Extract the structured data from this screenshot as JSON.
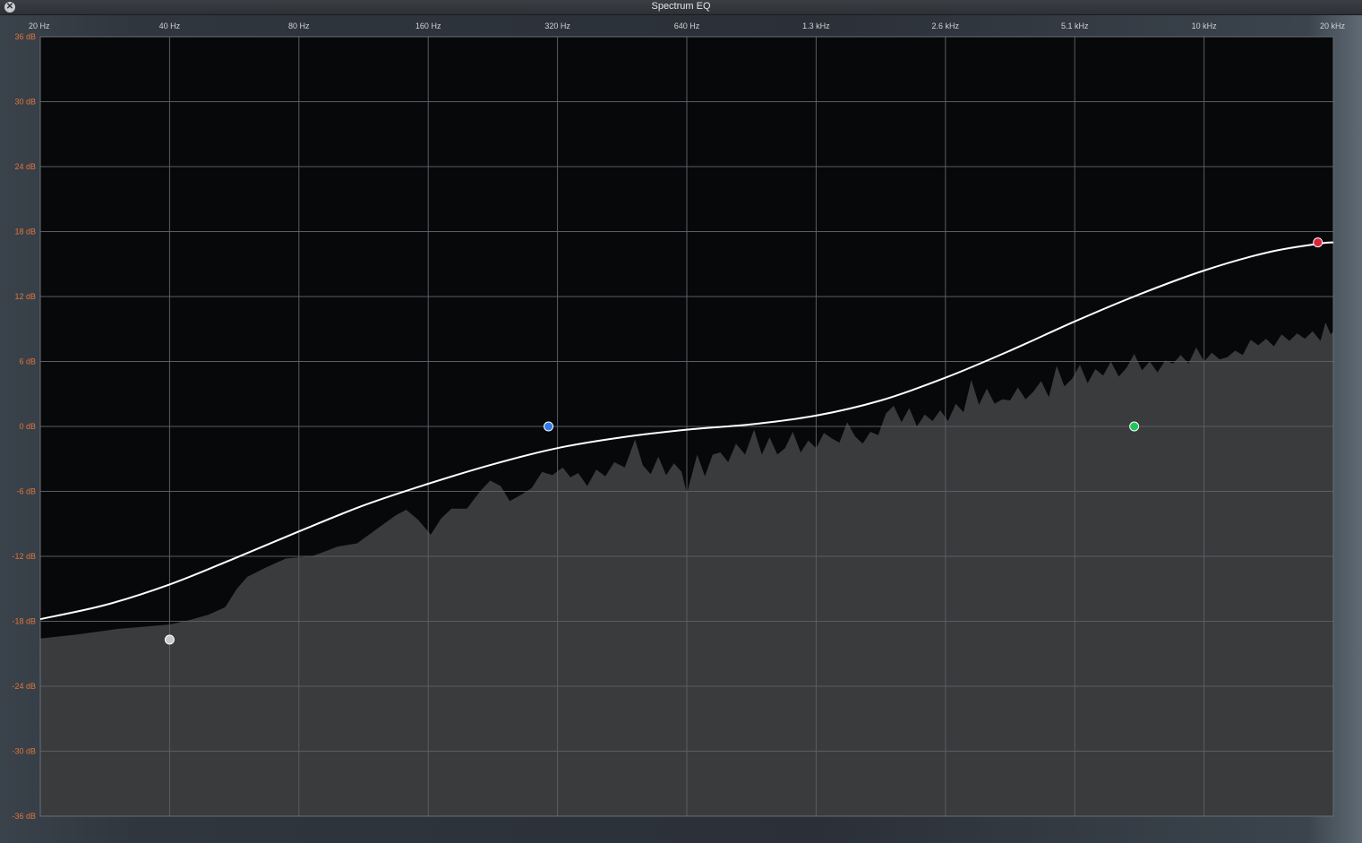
{
  "window": {
    "title": "Spectrum EQ",
    "close_icon": "close-icon"
  },
  "frequency_axis": {
    "labels": [
      "20 Hz",
      "40 Hz",
      "80 Hz",
      "160 Hz",
      "320 Hz",
      "640 Hz",
      "1.3 kHz",
      "2.6 kHz",
      "5.1 kHz",
      "10 kHz",
      "20 kHz"
    ]
  },
  "gain_axis": {
    "labels": [
      "36 dB",
      "30 dB",
      "24 dB",
      "18 dB",
      "12 dB",
      "6 dB",
      "0 dB",
      "-6 dB",
      "-12 dB",
      "-18 dB",
      "-24 dB",
      "-30 dB",
      "-36 dB"
    ],
    "min_db": -36,
    "max_db": 36,
    "label_color": "#e0763a"
  },
  "colors": {
    "plot_background": "#07080a",
    "spectrum_fill": "#3a3b3d",
    "grid": "#5a5d62",
    "eq_curve": "#ffffff"
  },
  "eq_curve": {
    "description_points": [
      [
        0,
        -17.8
      ],
      [
        0.05,
        -16.5
      ],
      [
        0.1,
        -14.6
      ],
      [
        0.15,
        -12.2
      ],
      [
        0.2,
        -9.7
      ],
      [
        0.25,
        -7.3
      ],
      [
        0.3,
        -5.3
      ],
      [
        0.35,
        -3.5
      ],
      [
        0.4,
        -2.0
      ],
      [
        0.45,
        -1.0
      ],
      [
        0.5,
        -0.3
      ],
      [
        0.55,
        0.2
      ],
      [
        0.6,
        1.0
      ],
      [
        0.65,
        2.4
      ],
      [
        0.7,
        4.5
      ],
      [
        0.75,
        7.0
      ],
      [
        0.8,
        9.7
      ],
      [
        0.85,
        12.2
      ],
      [
        0.9,
        14.4
      ],
      [
        0.95,
        16.1
      ],
      [
        0.99,
        16.9
      ],
      [
        1.0,
        17.0
      ]
    ]
  },
  "bands": [
    {
      "name": "low-shelf",
      "freq_pos": 0.1,
      "gain_db": -19.7,
      "color": "#c8c8c8"
    },
    {
      "name": "low-mid",
      "freq_pos": 0.393,
      "gain_db": 0,
      "color": "#2f7be8"
    },
    {
      "name": "high-mid",
      "freq_pos": 0.846,
      "gain_db": 0,
      "color": "#22c55e"
    },
    {
      "name": "high-shelf",
      "freq_pos": 0.988,
      "gain_db": 17.0,
      "color": "#e0223a"
    }
  ],
  "spectrum": {
    "points": [
      [
        0,
        -19.6
      ],
      [
        0.03,
        -19.2
      ],
      [
        0.06,
        -18.7
      ],
      [
        0.1,
        -18.3
      ],
      [
        0.115,
        -17.9
      ],
      [
        0.13,
        -17.4
      ],
      [
        0.143,
        -16.7
      ],
      [
        0.152,
        -15.0
      ],
      [
        0.16,
        -13.9
      ],
      [
        0.175,
        -13.0
      ],
      [
        0.19,
        -12.2
      ],
      [
        0.21,
        -12.0
      ],
      [
        0.23,
        -11.1
      ],
      [
        0.245,
        -10.8
      ],
      [
        0.26,
        -9.5
      ],
      [
        0.275,
        -8.2
      ],
      [
        0.283,
        -7.7
      ],
      [
        0.292,
        -8.6
      ],
      [
        0.302,
        -10.0
      ],
      [
        0.31,
        -8.5
      ],
      [
        0.318,
        -7.6
      ],
      [
        0.33,
        -7.6
      ],
      [
        0.34,
        -6.0
      ],
      [
        0.348,
        -5.0
      ],
      [
        0.356,
        -5.5
      ],
      [
        0.363,
        -6.9
      ],
      [
        0.372,
        -6.3
      ],
      [
        0.38,
        -5.7
      ],
      [
        0.388,
        -4.2
      ],
      [
        0.396,
        -4.5
      ],
      [
        0.404,
        -3.8
      ],
      [
        0.41,
        -4.7
      ],
      [
        0.416,
        -4.3
      ],
      [
        0.423,
        -5.5
      ],
      [
        0.43,
        -4.0
      ],
      [
        0.437,
        -4.6
      ],
      [
        0.444,
        -3.3
      ],
      [
        0.452,
        -3.8
      ],
      [
        0.46,
        -1.2
      ],
      [
        0.466,
        -3.6
      ],
      [
        0.472,
        -4.4
      ],
      [
        0.478,
        -2.8
      ],
      [
        0.484,
        -4.5
      ],
      [
        0.49,
        -3.4
      ],
      [
        0.496,
        -4.2
      ],
      [
        0.5,
        -6.2
      ],
      [
        0.504,
        -4.4
      ],
      [
        0.508,
        -2.6
      ],
      [
        0.514,
        -4.6
      ],
      [
        0.52,
        -2.6
      ],
      [
        0.526,
        -2.4
      ],
      [
        0.532,
        -3.3
      ],
      [
        0.538,
        -1.6
      ],
      [
        0.545,
        -2.6
      ],
      [
        0.552,
        -0.3
      ],
      [
        0.558,
        -2.6
      ],
      [
        0.564,
        -1.0
      ],
      [
        0.57,
        -2.6
      ],
      [
        0.576,
        -2.0
      ],
      [
        0.582,
        -0.5
      ],
      [
        0.588,
        -2.4
      ],
      [
        0.594,
        -1.3
      ],
      [
        0.6,
        -2.0
      ],
      [
        0.606,
        -0.6
      ],
      [
        0.612,
        -1.1
      ],
      [
        0.618,
        -1.5
      ],
      [
        0.624,
        0.4
      ],
      [
        0.63,
        -0.9
      ],
      [
        0.636,
        -1.6
      ],
      [
        0.642,
        -0.5
      ],
      [
        0.648,
        -0.8
      ],
      [
        0.654,
        1.2
      ],
      [
        0.66,
        1.9
      ],
      [
        0.666,
        0.4
      ],
      [
        0.672,
        1.7
      ],
      [
        0.678,
        0.0
      ],
      [
        0.684,
        1.1
      ],
      [
        0.69,
        0.5
      ],
      [
        0.696,
        1.5
      ],
      [
        0.702,
        0.5
      ],
      [
        0.708,
        2.1
      ],
      [
        0.714,
        1.3
      ],
      [
        0.72,
        4.3
      ],
      [
        0.726,
        2.0
      ],
      [
        0.732,
        3.5
      ],
      [
        0.738,
        2.1
      ],
      [
        0.744,
        2.5
      ],
      [
        0.75,
        2.4
      ],
      [
        0.756,
        3.6
      ],
      [
        0.762,
        2.5
      ],
      [
        0.768,
        3.2
      ],
      [
        0.774,
        4.2
      ],
      [
        0.78,
        2.7
      ],
      [
        0.786,
        5.6
      ],
      [
        0.792,
        3.7
      ],
      [
        0.798,
        4.4
      ],
      [
        0.804,
        5.7
      ],
      [
        0.81,
        4.0
      ],
      [
        0.816,
        5.3
      ],
      [
        0.822,
        4.7
      ],
      [
        0.828,
        6.0
      ],
      [
        0.834,
        4.6
      ],
      [
        0.84,
        5.4
      ],
      [
        0.846,
        6.7
      ],
      [
        0.852,
        5.2
      ],
      [
        0.858,
        6.0
      ],
      [
        0.864,
        5.0
      ],
      [
        0.87,
        6.1
      ],
      [
        0.876,
        5.8
      ],
      [
        0.882,
        6.6
      ],
      [
        0.888,
        5.8
      ],
      [
        0.894,
        7.3
      ],
      [
        0.9,
        6.0
      ],
      [
        0.906,
        6.8
      ],
      [
        0.912,
        6.2
      ],
      [
        0.918,
        6.4
      ],
      [
        0.924,
        7.0
      ],
      [
        0.93,
        6.6
      ],
      [
        0.936,
        8.0
      ],
      [
        0.942,
        7.5
      ],
      [
        0.948,
        8.1
      ],
      [
        0.954,
        7.4
      ],
      [
        0.96,
        8.5
      ],
      [
        0.966,
        7.9
      ],
      [
        0.972,
        8.6
      ],
      [
        0.978,
        8.1
      ],
      [
        0.984,
        8.8
      ],
      [
        0.99,
        7.9
      ],
      [
        0.994,
        9.6
      ],
      [
        0.998,
        8.5
      ],
      [
        1.0,
        8.8
      ]
    ]
  }
}
